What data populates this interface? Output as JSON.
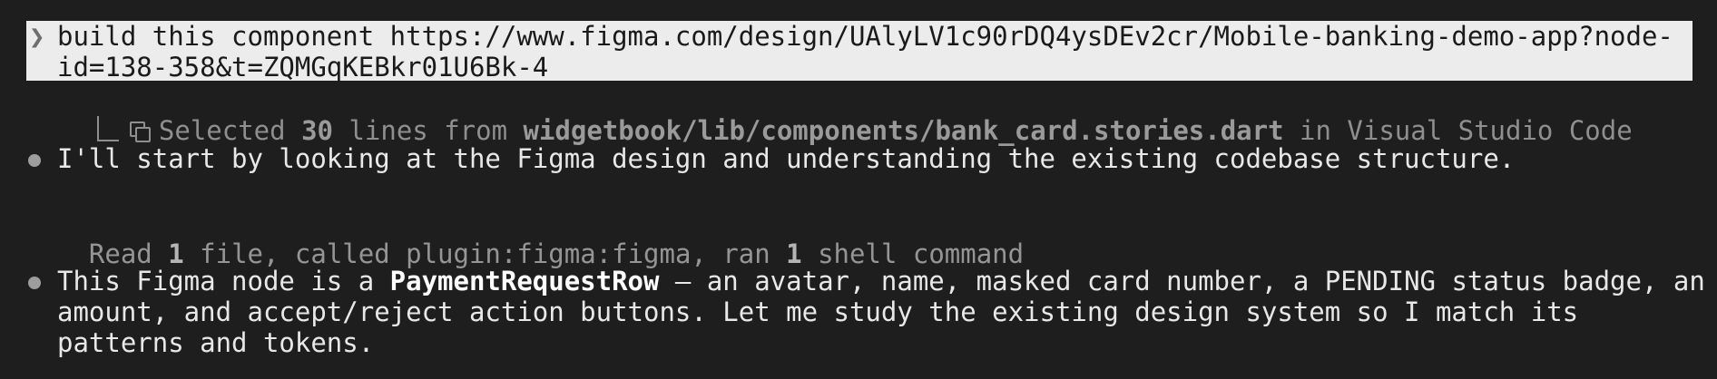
{
  "prompt": {
    "chevron": "❯",
    "text": "build this component https://www.figma.com/design/UAlyLV1c90rDQ4ysDEv2cr/Mobile-banking-demo-app?node-id=138-358&t=ZQMGqKEBkr01U6Bk-4"
  },
  "selection": {
    "prefix": "Selected ",
    "count": "30",
    "mid": " lines from ",
    "file": "widgetbook/lib/components/bank_card.stories.dart",
    "suffix": " in Visual Studio Code"
  },
  "messages": {
    "first": "I'll start by looking at the Figma design and understanding the existing codebase structure.",
    "tool_summary": {
      "read": "Read ",
      "read_count": "1",
      "middle": " file, called plugin:figma:figma, ran ",
      "ran_count": "1",
      "end": " shell command"
    },
    "second": {
      "prefix": "This Figma node is a ",
      "component": "PaymentRequestRow",
      "body": " — an avatar, name, masked card number, a PENDING status badge, an amount, and accept/reject action buttons. Let me study the existing design system so I match its patterns and tokens."
    }
  }
}
